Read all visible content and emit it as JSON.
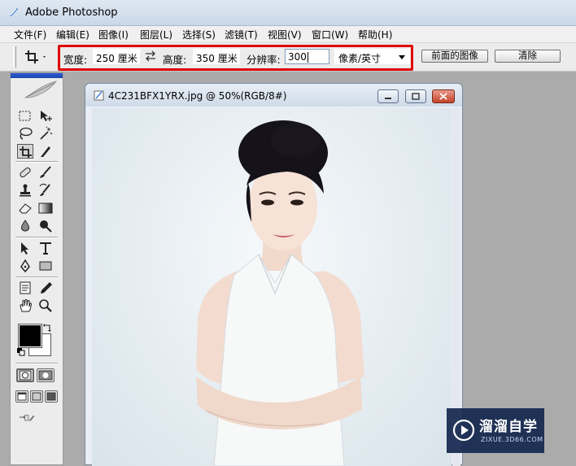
{
  "app": {
    "title": "Adobe Photoshop"
  },
  "menu": {
    "items": [
      "文件(F)",
      "编辑(E)",
      "图像(I)",
      "图层(L)",
      "选择(S)",
      "滤镜(T)",
      "视图(V)",
      "窗口(W)",
      "帮助(H)"
    ]
  },
  "options": {
    "width_label": "宽度:",
    "width_value": "250 厘米",
    "height_label": "高度:",
    "height_value": "350 厘米",
    "resolution_label": "分辨率:",
    "resolution_value": "300",
    "unit_value": "像素/英寸",
    "front_image_button": "前面的图像",
    "clear_button": "清除"
  },
  "document": {
    "title": "4C231BFX1YRX.jpg @ 50%(RGB/8#)"
  },
  "colors": {
    "foreground": "#000000",
    "background": "#ffffff",
    "highlight": "#e00000"
  },
  "watermark": {
    "text": "溜溜自学",
    "subtext": "ZIXUE.3D66.COM"
  }
}
